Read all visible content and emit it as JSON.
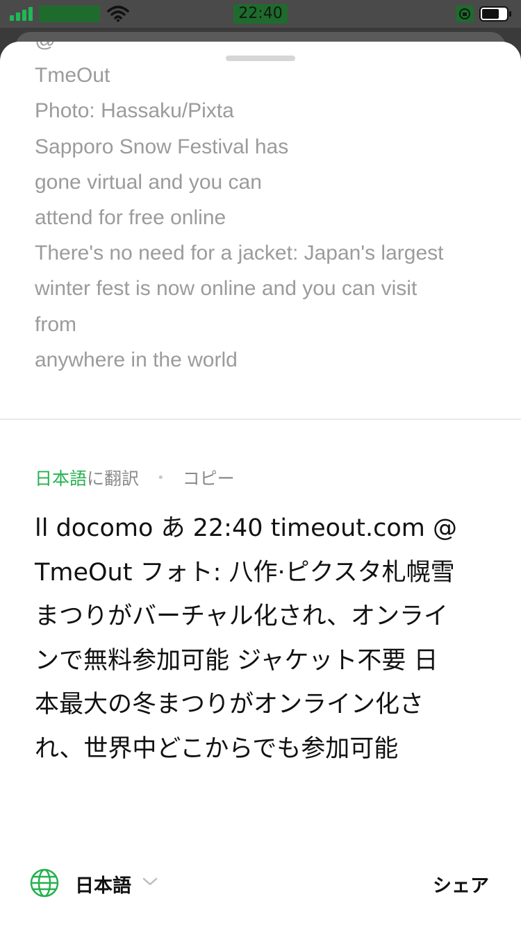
{
  "status_bar": {
    "time": "22:40",
    "icons": [
      "cellular-signal-icon",
      "wifi-icon",
      "rotation-lock-icon",
      "battery-icon"
    ],
    "accent": "#1db954"
  },
  "source": {
    "lines": [
      "@",
      "TmeOut",
      "Photo: Hassaku/Pixta",
      "Sapporo Snow Festival has",
      "gone virtual and you can",
      "attend for free online",
      "There's no need for a jacket: Japan's largest",
      "winter fest is now online and you can visit",
      "from",
      "anywhere in the world"
    ]
  },
  "actions": {
    "language": "日本語",
    "translate_suffix": "に翻訳",
    "separator": "•",
    "copy": "コピー"
  },
  "translation": {
    "lines": [
      "ll docomo あ 22:40 timeout.com @",
      "TmeOut フォト: 八作·ピクスタ札幌雪",
      "まつりがバーチャル化され、オンライ",
      "ンで無料参加可能 ジャケット不要 日",
      "本最大の冬まつりがオンライン化さ",
      "れ、世界中どこからでも参加可能"
    ]
  },
  "bottom_bar": {
    "language_label": "日本語",
    "share_label": "シェア",
    "icons": [
      "globe-icon",
      "chevron-down-icon"
    ]
  },
  "colors": {
    "accent_green": "#23b14d",
    "muted_text": "#9b9b9b",
    "body_text": "#111111"
  }
}
